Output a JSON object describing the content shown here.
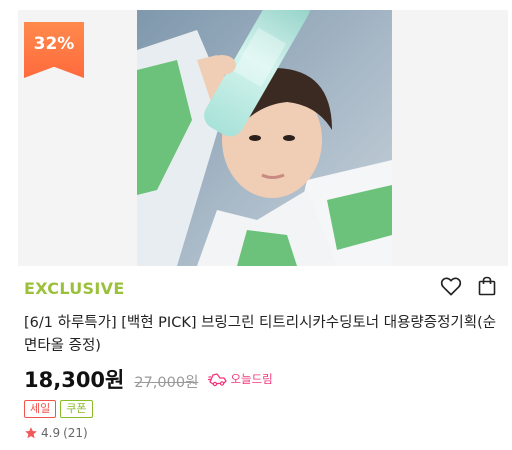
{
  "product": {
    "discount_badge": "32%",
    "brand_tag": "EXCLUSIVE",
    "title": "[6/1 하루특가] [백현 PICK] 브링그린 티트리시카수딩토너 대용량증정기획(순면타올 증정)",
    "price": "18,300원",
    "original_price": "27,000원",
    "delivery_label": "오늘드림",
    "tags": [
      "세일",
      "쿠폰"
    ],
    "rating": "4.9",
    "review_count": "(21)"
  },
  "colors": {
    "badge": "#ff7a45",
    "exclusive": "#9bc13c",
    "delivery": "#f2357b",
    "sale_tag": "#f2534b",
    "coupon_tag": "#8abb28",
    "star": "#f05a5a"
  },
  "icons": {
    "wishlist": "heart-icon",
    "cart": "shopping-bag-icon",
    "delivery": "delivery-truck-icon",
    "rating": "star-icon"
  }
}
